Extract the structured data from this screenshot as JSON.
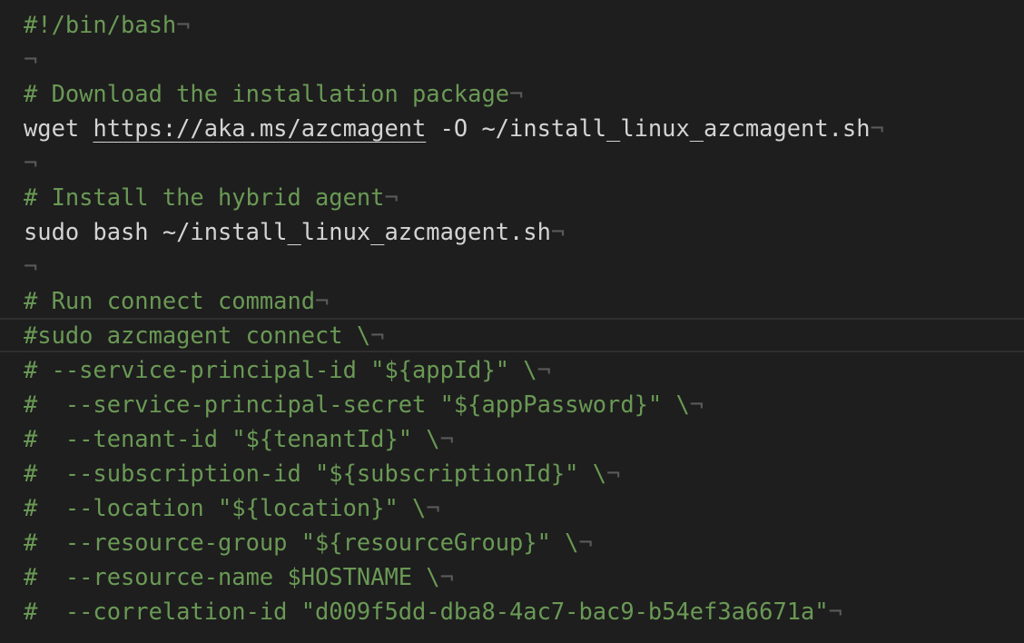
{
  "editor": {
    "eol_marker": "¬",
    "lines": [
      {
        "segments": [
          {
            "kind": "comment",
            "text": "#!/bin/bash"
          }
        ]
      },
      {
        "segments": []
      },
      {
        "segments": [
          {
            "kind": "comment",
            "text": "# Download the installation package"
          }
        ]
      },
      {
        "segments": [
          {
            "kind": "plain",
            "text": "wget "
          },
          {
            "kind": "link",
            "text": "https://aka.ms/azcmagent"
          },
          {
            "kind": "plain",
            "text": " -O ~/install_linux_azcmagent.sh"
          }
        ]
      },
      {
        "segments": []
      },
      {
        "segments": [
          {
            "kind": "comment",
            "text": "# Install the hybrid agent"
          }
        ]
      },
      {
        "segments": [
          {
            "kind": "plain",
            "text": "sudo bash ~/install_linux_azcmagent.sh"
          }
        ]
      },
      {
        "segments": []
      },
      {
        "segments": [
          {
            "kind": "comment",
            "text": "# Run connect command"
          }
        ]
      },
      {
        "current": true,
        "segments": [
          {
            "kind": "comment",
            "text": "#sudo azcmagent connect \\"
          }
        ]
      },
      {
        "segments": [
          {
            "kind": "comment",
            "text": "# --service-principal-id \"${appId}\" \\"
          }
        ]
      },
      {
        "segments": [
          {
            "kind": "comment",
            "text": "#  --service-principal-secret \"${appPassword}\" \\"
          }
        ]
      },
      {
        "segments": [
          {
            "kind": "comment",
            "text": "#  --tenant-id \"${tenantId}\" \\"
          }
        ]
      },
      {
        "segments": [
          {
            "kind": "comment",
            "text": "#  --subscription-id \"${subscriptionId}\" \\"
          }
        ]
      },
      {
        "segments": [
          {
            "kind": "comment",
            "text": "#  --location \"${location}\" \\"
          }
        ]
      },
      {
        "segments": [
          {
            "kind": "comment",
            "text": "#  --resource-group \"${resourceGroup}\" \\"
          }
        ]
      },
      {
        "segments": [
          {
            "kind": "comment",
            "text": "#  --resource-name $HOSTNAME \\"
          }
        ]
      },
      {
        "segments": [
          {
            "kind": "comment",
            "text": "#  --correlation-id \"d009f5dd-dba8-4ac7-bac9-b54ef3a6671a\""
          }
        ]
      }
    ]
  },
  "colors": {
    "background": "#1e1e1e",
    "comment": "#6a9955",
    "text": "#d4d4d4",
    "whitespace_marker": "#5a5a5a",
    "current_line_border": "#2f2f2f"
  }
}
